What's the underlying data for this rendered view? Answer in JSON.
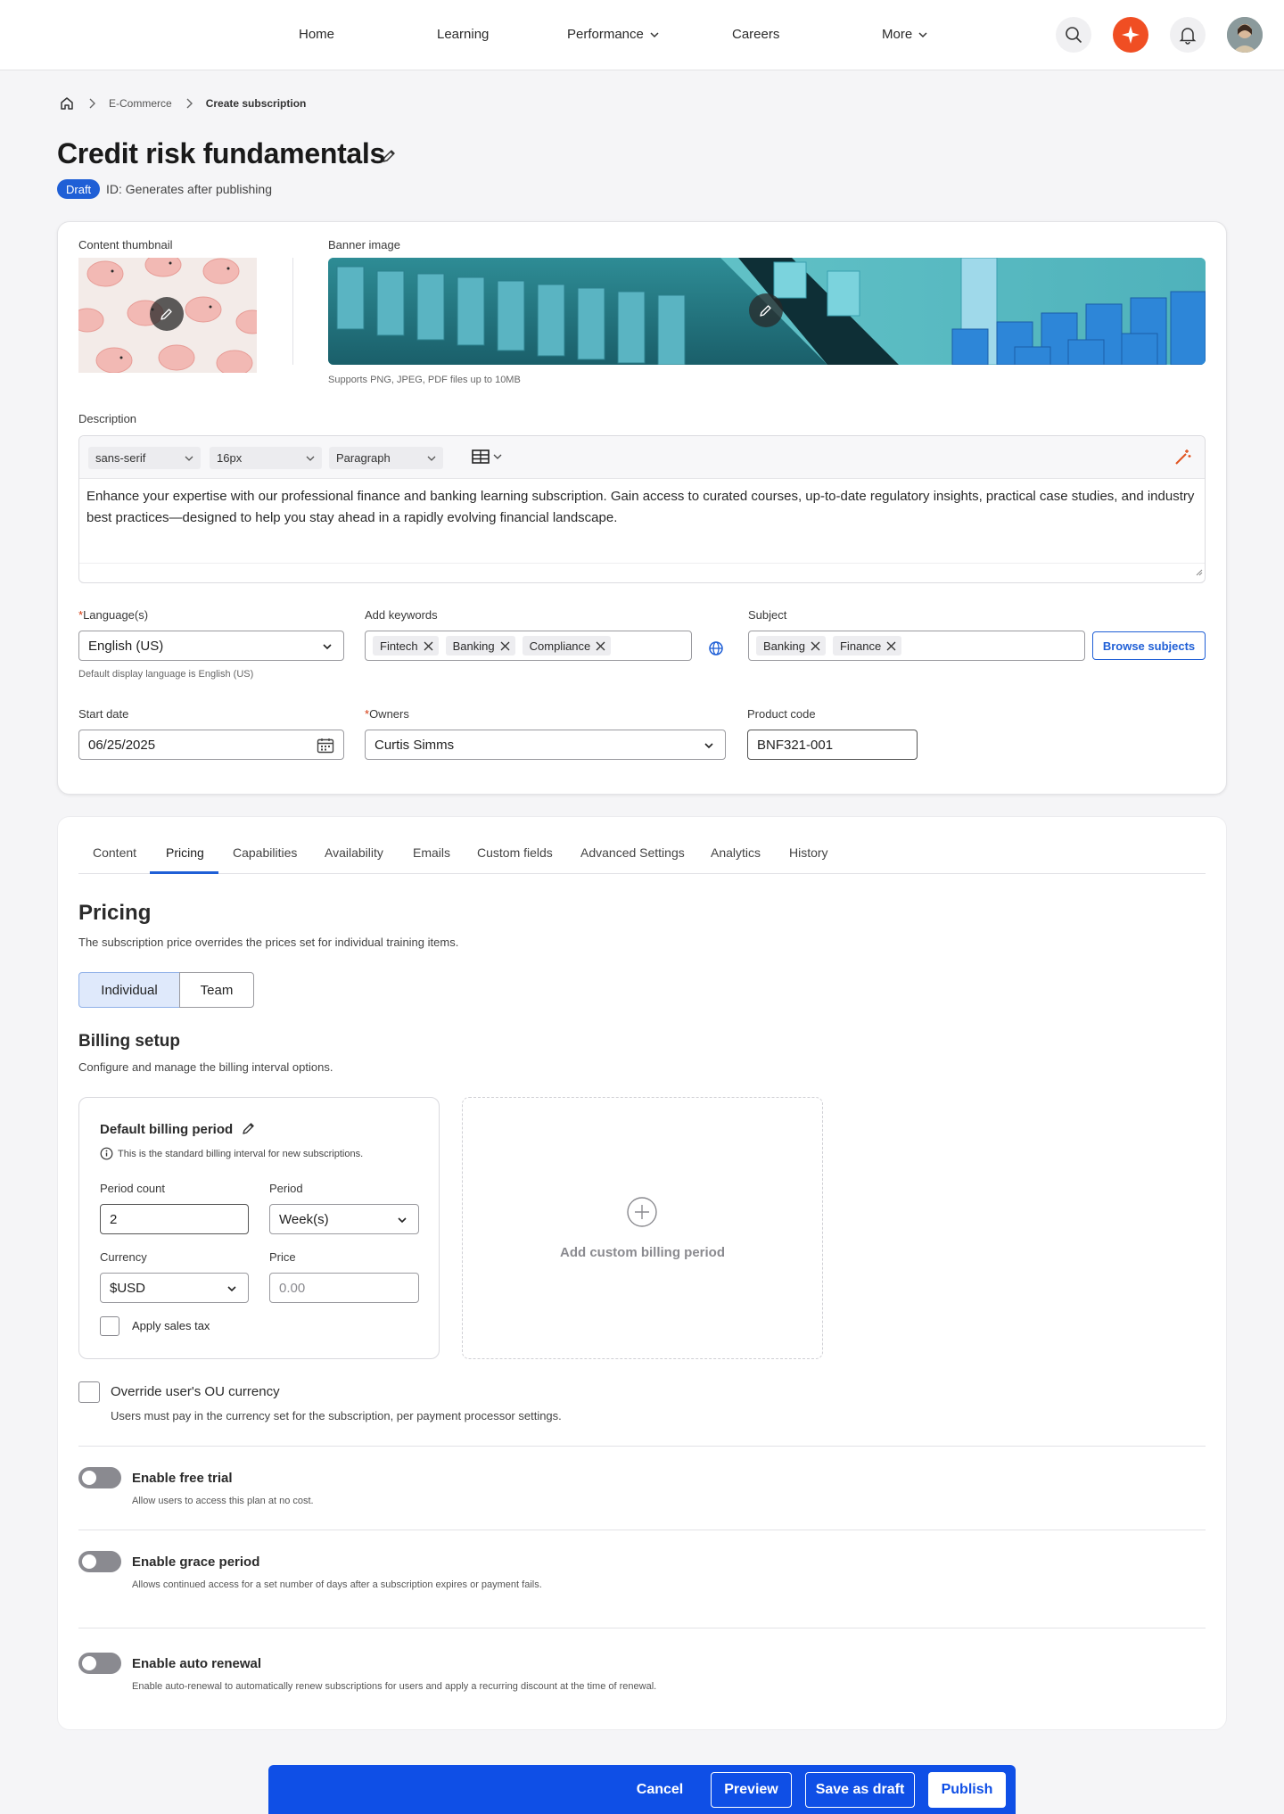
{
  "nav": {
    "items": [
      {
        "label": "Home"
      },
      {
        "label": "Learning"
      },
      {
        "label": "Performance"
      },
      {
        "label": "Careers"
      },
      {
        "label": "More"
      }
    ]
  },
  "breadcrumb": {
    "items": [
      "E-Commerce",
      "Create subscription"
    ]
  },
  "page": {
    "title": "Credit risk fundamentals",
    "status_badge": "Draft",
    "id_text": "ID: Generates after publishing"
  },
  "media": {
    "thumbnail_label": "Content thumbnail",
    "banner_label": "Banner image",
    "banner_hint": "Supports PNG, JPEG, PDF files up to 10MB"
  },
  "description": {
    "label": "Description",
    "font_family": "sans-serif",
    "font_size": "16px",
    "block_format": "Paragraph",
    "text": "Enhance your expertise with our professional finance and banking learning subscription. Gain access to curated courses, up-to-date regulatory insights, practical case studies, and industry best practices—designed to help you stay ahead in a rapidly evolving financial landscape."
  },
  "form": {
    "language_label": "Language(s)",
    "language_value": "English (US)",
    "language_hint": "Default display language is English (US)",
    "keywords_label": "Add keywords",
    "keywords": [
      "Fintech",
      "Banking",
      "Compliance"
    ],
    "subject_label": "Subject",
    "subjects": [
      "Banking",
      "Finance"
    ],
    "browse_subjects": "Browse subjects",
    "start_date_label": "Start date",
    "start_date_value": "06/25/2025",
    "owners_label": "Owners",
    "owners_value": "Curtis Simms",
    "product_code_label": "Product code",
    "product_code_value": "BNF321-001"
  },
  "tabs": [
    {
      "label": "Content"
    },
    {
      "label": "Pricing"
    },
    {
      "label": "Capabilities"
    },
    {
      "label": "Availability"
    },
    {
      "label": "Emails"
    },
    {
      "label": "Custom fields"
    },
    {
      "label": "Advanced Settings"
    },
    {
      "label": "Analytics"
    },
    {
      "label": "History"
    }
  ],
  "pricing": {
    "title": "Pricing",
    "subtitle": "The subscription price overrides the prices set for individual training items.",
    "segment_individual": "Individual",
    "segment_team": "Team",
    "billing_title": "Billing setup",
    "billing_subtitle": "Configure and manage the billing interval options.",
    "default_period_title": "Default billing period",
    "default_period_info": "This is the standard billing interval for new subscriptions.",
    "period_count_label": "Period count",
    "period_count_value": "2",
    "period_label": "Period",
    "period_value": "Week(s)",
    "currency_label": "Currency",
    "currency_value": "$USD",
    "price_label": "Price",
    "price_placeholder": "0.00",
    "sales_tax_label": "Apply sales tax",
    "add_custom_label": "Add custom billing period",
    "override_title": "Override user's OU currency",
    "override_desc": "Users must pay in the currency set for the subscription, per payment processor settings.",
    "free_trial_title": "Enable free trial",
    "free_trial_desc": "Allow users to access this plan at no cost.",
    "grace_title": "Enable grace period",
    "grace_desc": "Allows continued access for a set number of days after a subscription expires or payment fails.",
    "auto_renew_title": "Enable auto renewal",
    "auto_renew_desc": "Enable auto-renewal to automatically renew subscriptions for users and apply a recurring discount at the time of renewal."
  },
  "actions": {
    "cancel": "Cancel",
    "preview": "Preview",
    "save_draft": "Save as draft",
    "publish": "Publish"
  },
  "colors": {
    "accent": "#1f5fd6",
    "action_bar": "#0f4fe6",
    "ai_button": "#f04e23"
  }
}
